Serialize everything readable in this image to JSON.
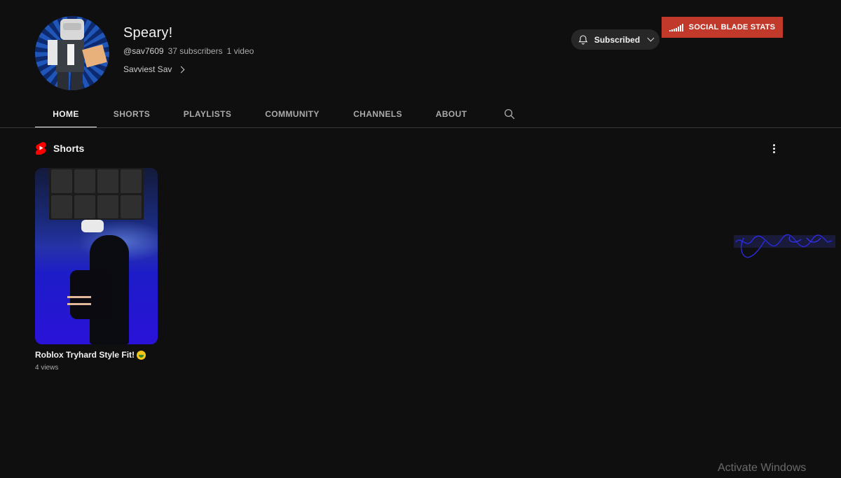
{
  "channel": {
    "name": "Speary!",
    "handle": "@sav7609",
    "subscribers": "37 subscribers",
    "videos": "1 video",
    "link_text": "Savviest Sav"
  },
  "actions": {
    "subscribed_label": "Subscribed",
    "social_blade_label": "SOCIAL BLADE STATS"
  },
  "tabs": [
    {
      "label": "HOME",
      "active": true
    },
    {
      "label": "SHORTS",
      "active": false
    },
    {
      "label": "PLAYLISTS",
      "active": false
    },
    {
      "label": "COMMUNITY",
      "active": false
    },
    {
      "label": "CHANNELS",
      "active": false
    },
    {
      "label": "ABOUT",
      "active": false
    }
  ],
  "shorts_section": {
    "title": "Shorts",
    "items": [
      {
        "title": "Roblox Tryhard Style Fit!",
        "views": "4 views"
      }
    ]
  },
  "watermark": "Activate Windows",
  "colors": {
    "background": "#0f0f0f",
    "social_blade": "#c0392b",
    "shorts_red": "#ff0000",
    "subscribed_bg": "#272727"
  },
  "icons": [
    "bell-icon",
    "chevron-down-icon",
    "chevron-right-icon",
    "signal-bars-icon",
    "search-icon",
    "shorts-logo-icon",
    "more-vert-icon"
  ]
}
